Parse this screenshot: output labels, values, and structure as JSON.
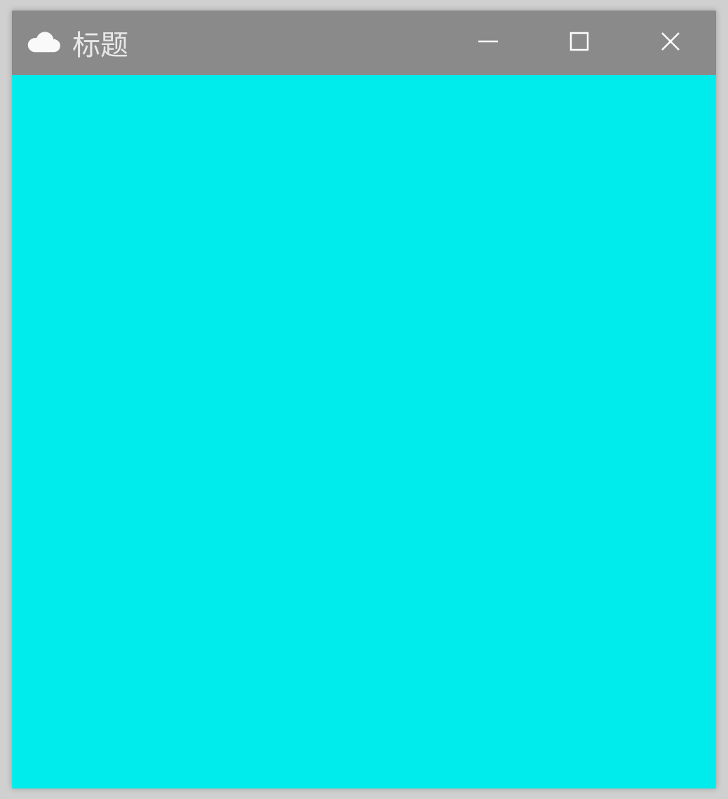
{
  "window": {
    "title": "标题",
    "icon_name": "cloud-icon"
  },
  "colors": {
    "titlebar_bg": "#8a8a8a",
    "content_bg": "#00ecec",
    "titlebar_fg": "#ffffff"
  }
}
